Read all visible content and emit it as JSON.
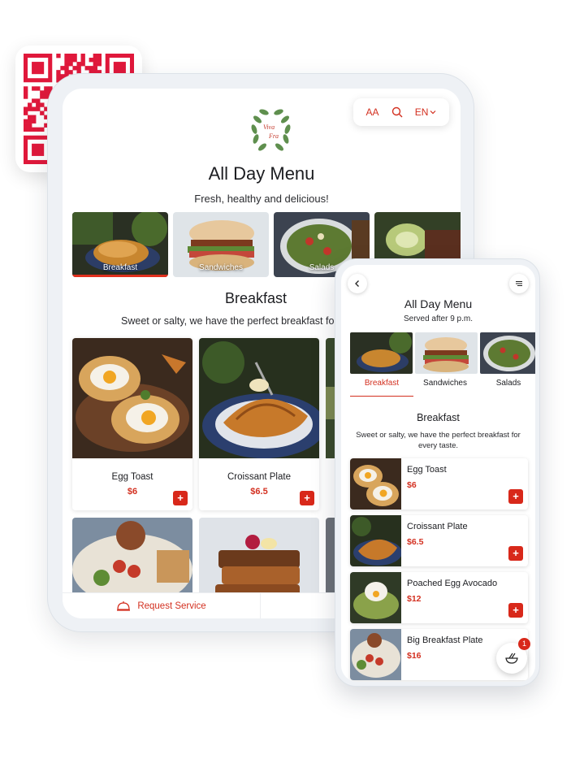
{
  "colors": {
    "accent": "#d8281a",
    "accent_text": "#d33020",
    "background": "#ffffff",
    "device_frame": "#eef1f5"
  },
  "tablet": {
    "logo": {
      "text_line1": "Viva",
      "text_line2": "Fra"
    },
    "toolbar": {
      "font_size_label": "AA",
      "search_icon": "search-icon",
      "language": "EN"
    },
    "title": "All Day Menu",
    "subtitle": "Fresh, healthy and delicious!",
    "categories": [
      {
        "label": "Breakfast",
        "active": true
      },
      {
        "label": "Sandwiches",
        "active": false
      },
      {
        "label": "Salads",
        "active": false
      },
      {
        "label": "",
        "active": false
      }
    ],
    "section": {
      "title": "Breakfast",
      "description": "Sweet or salty, we have the perfect breakfast fo"
    },
    "items": [
      {
        "name": "Egg Toast",
        "price": "$6",
        "add": "+"
      },
      {
        "name": "Croissant Plate",
        "price": "$6.5",
        "add": "+"
      }
    ],
    "bottom_bar": {
      "request_service": "Request Service"
    }
  },
  "phone": {
    "title": "All Day Menu",
    "subtitle": "Served after 9 p.m.",
    "tabs": [
      {
        "label": "Breakfast",
        "active": true
      },
      {
        "label": "Sandwiches",
        "active": false
      },
      {
        "label": "Salads",
        "active": false
      }
    ],
    "section": {
      "title": "Breakfast",
      "description": "Sweet or salty, we have the perfect breakfast for every taste."
    },
    "items": [
      {
        "name": "Egg Toast",
        "price": "$6",
        "add": "+"
      },
      {
        "name": "Croissant Plate",
        "price": "$6.5",
        "add": "+"
      },
      {
        "name": "Poached Egg Avocado",
        "price": "$12",
        "add": "+"
      },
      {
        "name": "Big Breakfast Plate",
        "price": "$16"
      }
    ],
    "cart": {
      "count": "1",
      "icon": "food-bowl-icon"
    }
  }
}
